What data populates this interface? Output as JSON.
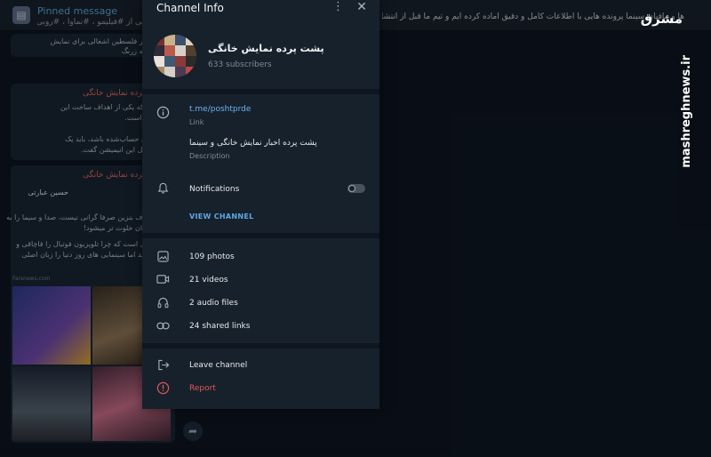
{
  "background": {
    "pinned_title": "Pinned message",
    "pinned_text": "ها و مافیای سینما پرونده هایی با اطلاعات کامل و دقیق آماده کرده ایم و تیم ما قبل از انتشار",
    "pinned_line2": "بی از #فیلیمو ، #نماوا ، #روبی",
    "msg1_lines": [
      "متعدد در فلسطین اشغالی برای نمایش",
      "مون بچه زرنگ"
    ],
    "msg2_author": "پشت پرده نمایش خانگی",
    "msg2_lines": [
      "ی‌شود که یکی از اهداف ساخت این",
      "ضا (ع) است.",
      "فرهنگی حساب‌شده باشد، باید یک",
      "به عوامل این انیمیشن گفت."
    ],
    "msg3_author": "پشت پرده نمایش خانگی",
    "msg3_tweet_name": "حسین عبارتی",
    "msg3_lines": [
      "ی مصرف بنزین صرفا گرانی نیست، صدا و سیما را به",
      "یم، خیابان خلوت تر میشود!",
      "ن سوال است که چرا تلویزیون فوتبال را قاچاقی و",
      "ش میکند اما سینمایی های روز دنیا را زبان اصلی",
      "!؟"
    ],
    "source_tag": "Farsnews.com"
  },
  "watermark": {
    "logo": "مشرق",
    "site": "mashreghnews.ir"
  },
  "dialog": {
    "title": "Channel Info",
    "channel_name": "پشت پرده نمایش خانگی",
    "subscribers": "633 subscribers",
    "link": "t.me/poshtprde",
    "link_label": "Link",
    "description": "پشت پرده اخبار نمایش خانگی و سینما",
    "description_label": "Description",
    "notifications_label": "Notifications",
    "notifications_on": false,
    "view_channel": "VIEW CHANNEL",
    "media": [
      {
        "icon": "photo-icon",
        "label": "109 photos"
      },
      {
        "icon": "video-icon",
        "label": "21 videos"
      },
      {
        "icon": "headphones-icon",
        "label": "2 audio files"
      },
      {
        "icon": "link-icon",
        "label": "24 shared links"
      }
    ],
    "leave_label": "Leave channel",
    "report_label": "Report"
  },
  "colors": {
    "accent": "#6ab2f2",
    "danger": "#e0565b",
    "panel": "#17212b",
    "bg": "#0e1621"
  }
}
